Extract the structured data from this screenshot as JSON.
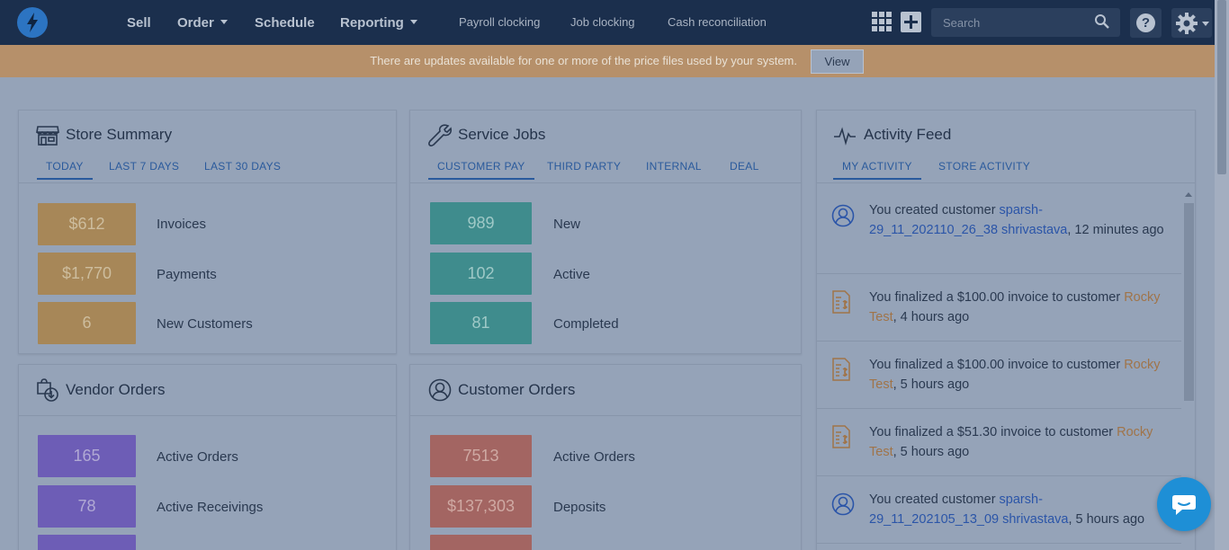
{
  "nav": {
    "items": [
      {
        "label": "Sell",
        "dropdown": false
      },
      {
        "label": "Order",
        "dropdown": true
      },
      {
        "label": "Schedule",
        "dropdown": false
      },
      {
        "label": "Reporting",
        "dropdown": true
      }
    ],
    "links": [
      "Payroll clocking",
      "Job clocking",
      "Cash reconciliation"
    ],
    "search_placeholder": "Search",
    "help_label": "?"
  },
  "banner": {
    "text": "There are updates available for one or more of the price files used by your system.",
    "button_label": "View",
    "color": "#b6906a"
  },
  "store_summary": {
    "title": "Store Summary",
    "tabs": [
      "TODAY",
      "LAST 7 DAYS",
      "LAST 30 DAYS"
    ],
    "active_tab": 0,
    "stats": [
      {
        "value": "$612",
        "label": "Invoices"
      },
      {
        "value": "$1,770",
        "label": "Payments"
      },
      {
        "value": "6",
        "label": "New Customers"
      }
    ],
    "color": "#a78758"
  },
  "service_jobs": {
    "title": "Service Jobs",
    "tabs": [
      "CUSTOMER PAY",
      "THIRD PARTY",
      "INTERNAL",
      "DEAL"
    ],
    "active_tab": 0,
    "stats": [
      {
        "value": "989",
        "label": "New"
      },
      {
        "value": "102",
        "label": "Active"
      },
      {
        "value": "81",
        "label": "Completed"
      }
    ],
    "color": "#3f8c8d"
  },
  "vendor_orders": {
    "title": "Vendor Orders",
    "stats": [
      {
        "value": "165",
        "label": "Active Orders"
      },
      {
        "value": "78",
        "label": "Active Receivings"
      }
    ],
    "color": "#6d5db6"
  },
  "customer_orders": {
    "title": "Customer Orders",
    "stats": [
      {
        "value": "7513",
        "label": "Active Orders"
      },
      {
        "value": "$137,303",
        "label": "Deposits"
      }
    ],
    "color": "#a36562"
  },
  "activity_feed": {
    "title": "Activity Feed",
    "tabs": [
      "MY ACTIVITY",
      "STORE ACTIVITY"
    ],
    "active_tab": 0,
    "items": [
      {
        "icon": "user-icon",
        "prefix": "You created customer ",
        "link": "sparsh-29_11_202110_26_38 shrivastava",
        "link_type": "customer",
        "suffix": ", 12 minutes ago"
      },
      {
        "icon": "invoice-icon",
        "prefix": "You finalized a $100.00 invoice to customer ",
        "link": "Rocky Test",
        "link_type": "invoice",
        "suffix": ", 4 hours ago"
      },
      {
        "icon": "invoice-icon",
        "prefix": "You finalized a $100.00 invoice to customer ",
        "link": "Rocky Test",
        "link_type": "invoice",
        "suffix": ", 5 hours ago"
      },
      {
        "icon": "invoice-icon",
        "prefix": "You finalized a $51.30 invoice to customer ",
        "link": "Rocky Test",
        "link_type": "invoice",
        "suffix": ", 5 hours ago"
      },
      {
        "icon": "user-icon",
        "prefix": "You created customer ",
        "link": "sparsh-29_11_202105_13_09 shrivastava",
        "link_type": "customer",
        "suffix": ", 5 hours ago"
      }
    ]
  },
  "chat": {
    "icon": "chat-icon",
    "color": "#1e8fd6"
  }
}
